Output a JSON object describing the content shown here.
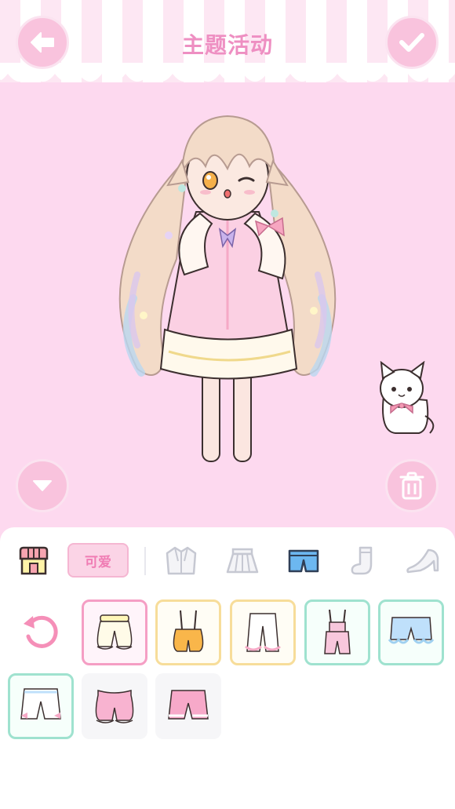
{
  "header": {
    "title": "主题活动"
  },
  "buttons": {
    "back_icon": "arrow-left-icon",
    "confirm_icon": "checkmark-icon",
    "collapse_icon": "chevron-down-icon",
    "delete_icon": "trash-icon"
  },
  "category_bar": {
    "shop_icon": "shop-icon",
    "tag_label": "可爱",
    "tabs": [
      "jacket-icon",
      "skirt-icon",
      "shorts-icon",
      "sock-icon",
      "heel-shoe-icon"
    ],
    "selected_tab": "shorts-icon"
  },
  "items": [
    {
      "name": "white-bloomers",
      "border": "pink"
    },
    {
      "name": "orange-suspender-shorts",
      "border": "yellow"
    },
    {
      "name": "white-ruffle-pants",
      "border": "yellow"
    },
    {
      "name": "pink-overalls",
      "border": "teal"
    },
    {
      "name": "blue-lace-shorts",
      "border": "teal"
    },
    {
      "name": "white-bow-shorts",
      "border": "teal"
    },
    {
      "name": "pink-bloomers",
      "border": "none"
    },
    {
      "name": "pink-shorts",
      "border": "none"
    }
  ],
  "colors": {
    "background": "#fdd9ef",
    "accent": "#ee8fc2",
    "button": "#f9c3dd"
  }
}
